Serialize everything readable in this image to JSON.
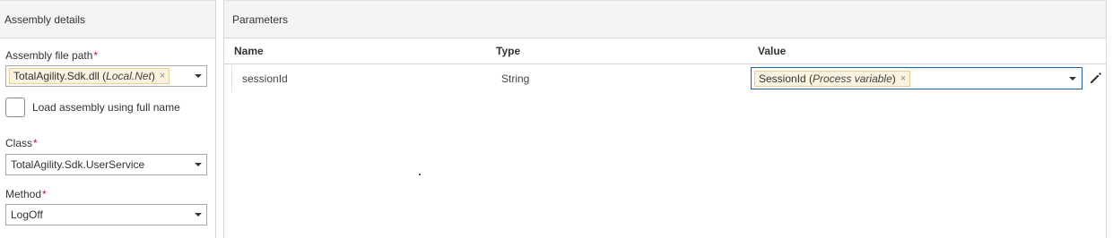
{
  "assembly_details": {
    "header": "Assembly details",
    "file_path_label": "Assembly file path",
    "required_mark": "*",
    "file_path_tag": {
      "name": "TotalAgility.Sdk.dll",
      "open_paren": "(",
      "scope": "Local.Net",
      "close_paren": ")",
      "remove": "×"
    },
    "load_full_name_label": "Load assembly using full name",
    "load_full_name_checked": false,
    "class_label": "Class",
    "class_value": "TotalAgility.Sdk.UserService",
    "method_label": "Method",
    "method_value": "LogOff"
  },
  "parameters": {
    "header": "Parameters",
    "columns": {
      "name": "Name",
      "type": "Type",
      "value": "Value"
    },
    "rows": [
      {
        "name": "sessionId",
        "type": "String",
        "value_tag": {
          "name": "SessionId",
          "open_paren": "(",
          "kind": "Process variable",
          "close_paren": ")",
          "remove": "×"
        }
      }
    ]
  },
  "icons": {
    "dropdown": "chevron-down-icon",
    "edit": "pencil-icon",
    "remove": "close-icon"
  },
  "colors": {
    "tag_bg": "#fbf3e0",
    "tag_border": "#e8cf94",
    "required": "#c8102e",
    "focus_border": "#1e5fa8"
  }
}
